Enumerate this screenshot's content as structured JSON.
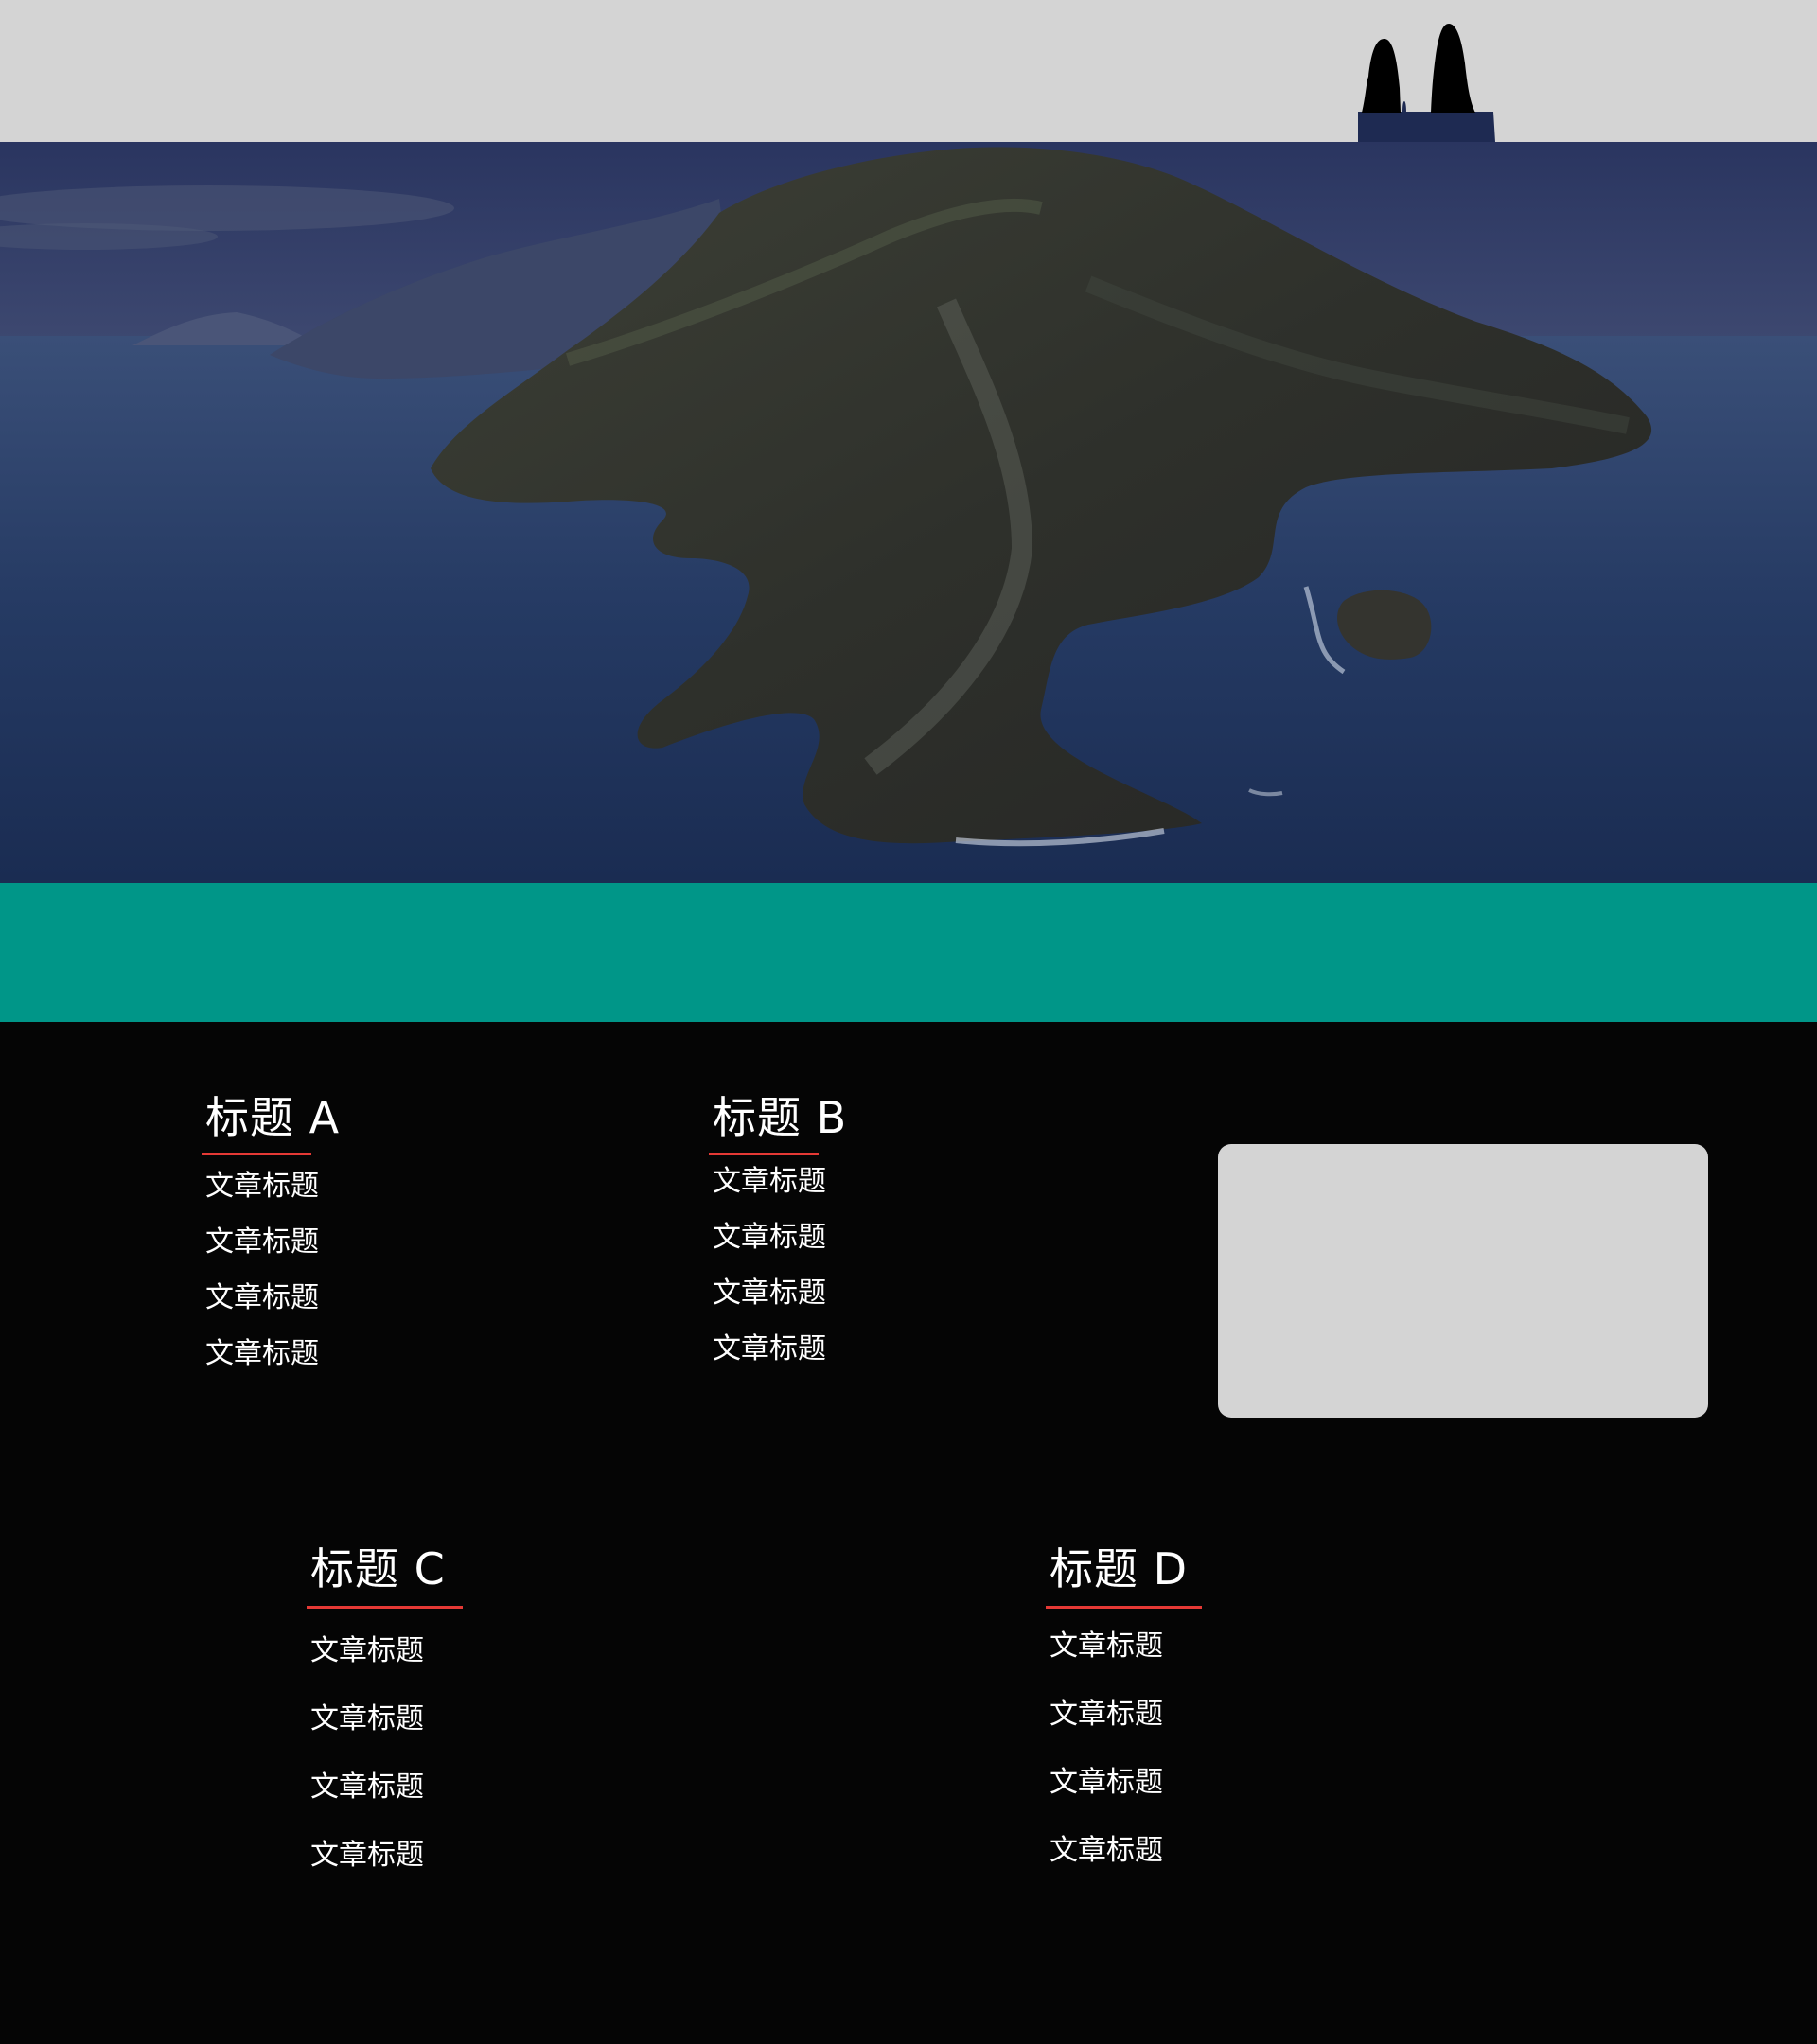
{
  "colors": {
    "header_bg": "#d4d4d4",
    "band_bg": "#009688",
    "footer_bg": "#050505",
    "accent_line": "#e53935",
    "card_bg": "#d4d4d4"
  },
  "header": {
    "logo_icon": "twin-peaks-logo-icon"
  },
  "hero": {
    "image": "island-coast-night-photo"
  },
  "footer": {
    "columns": [
      {
        "title": "标题 A",
        "items": [
          "文章标题",
          "文章标题",
          "文章标题",
          "文章标题"
        ]
      },
      {
        "title": "标题 B",
        "items": [
          "文章标题",
          "文章标题",
          "文章标题",
          "文章标题"
        ]
      },
      {
        "title": "标题 C",
        "items": [
          "文章标题",
          "文章标题",
          "文章标题",
          "文章标题"
        ]
      },
      {
        "title": "标题 D",
        "items": [
          "文章标题",
          "文章标题",
          "文章标题",
          "文章标题"
        ]
      }
    ]
  }
}
